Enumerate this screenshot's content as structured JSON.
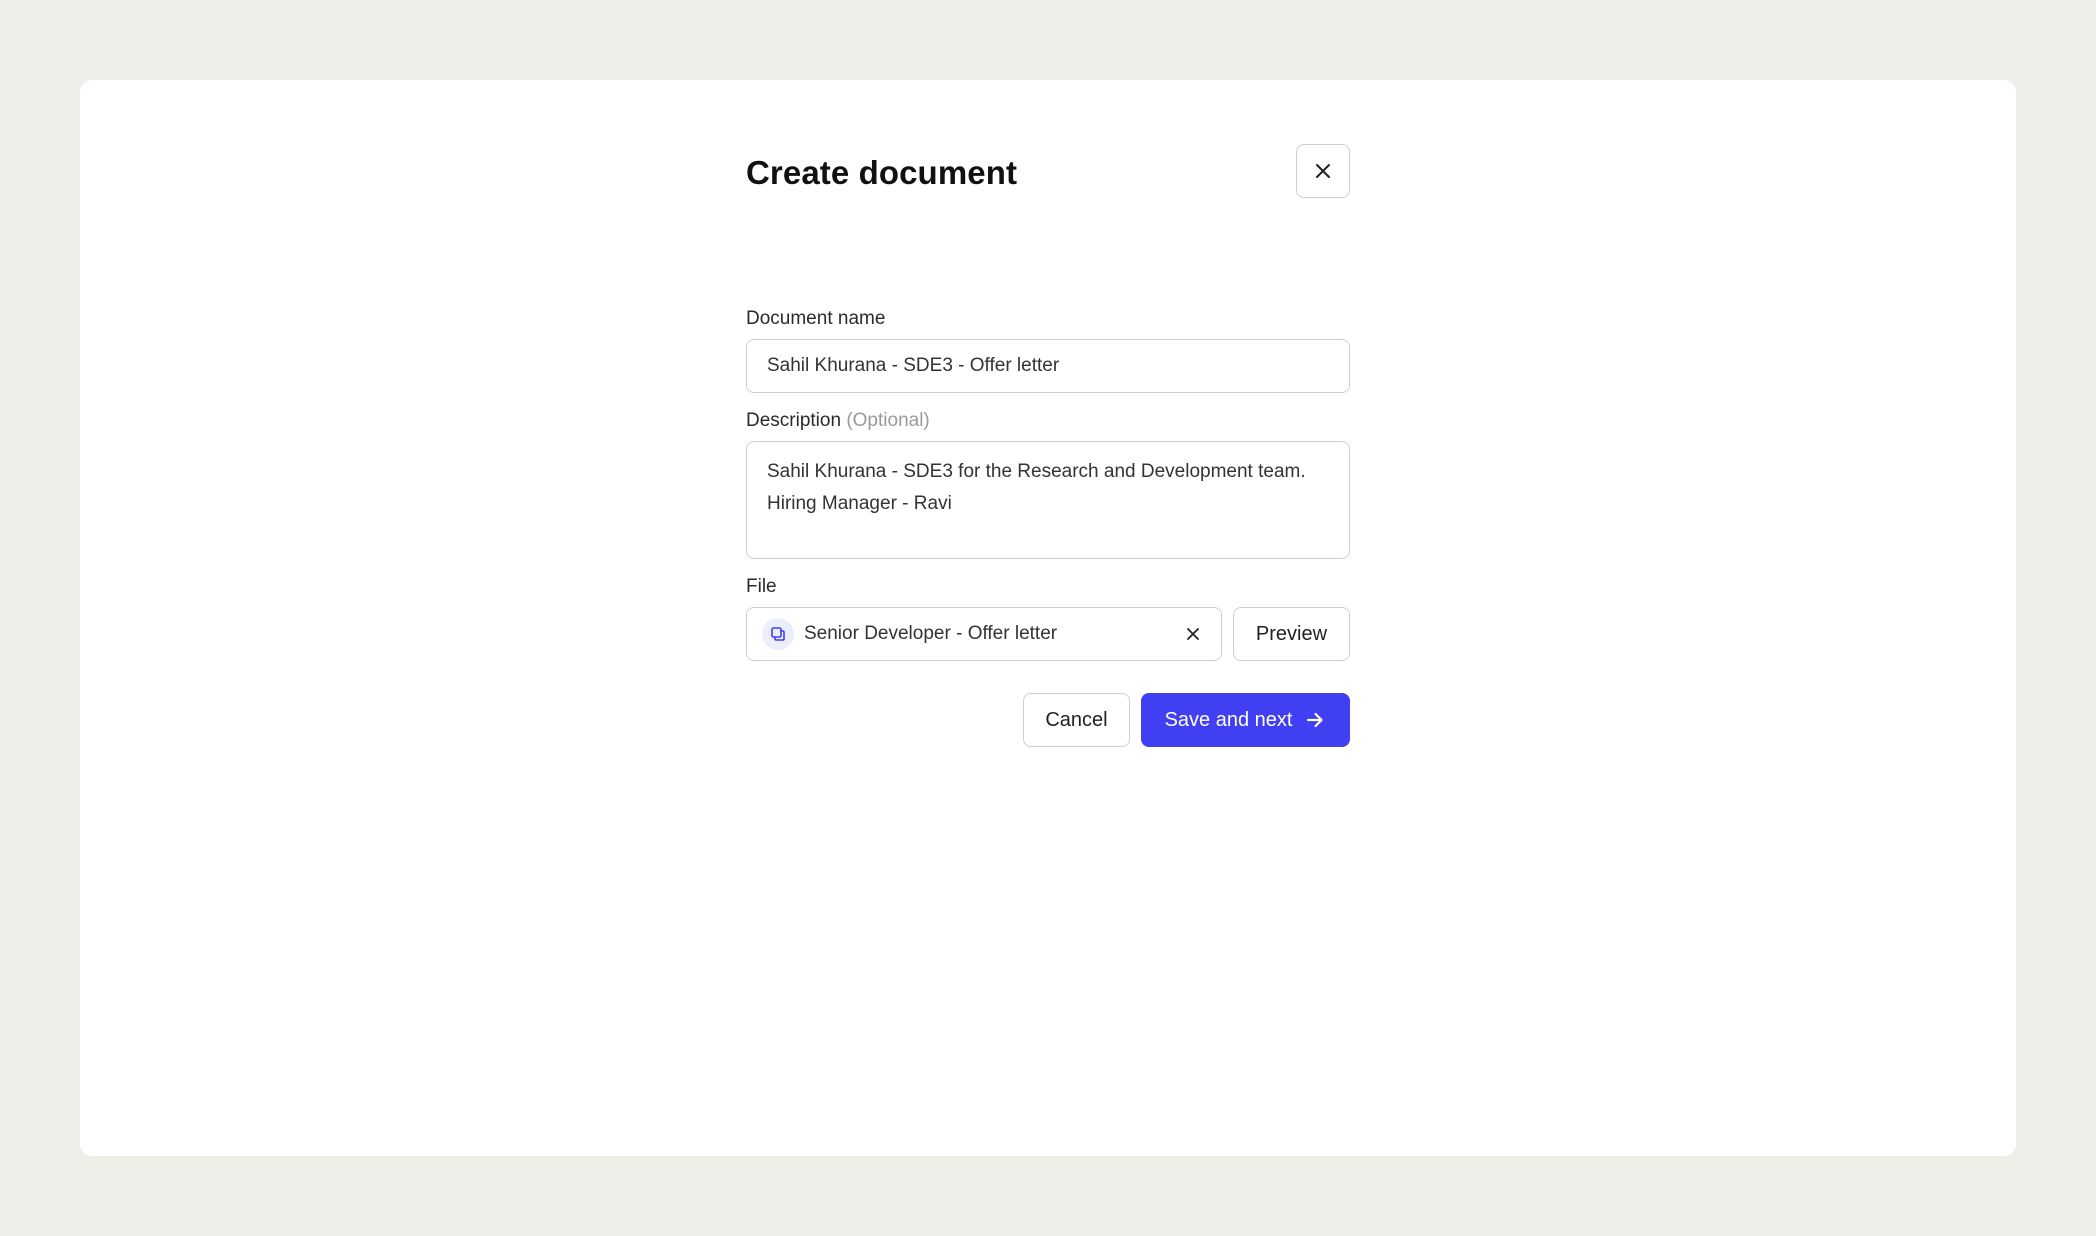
{
  "dialog": {
    "title": "Create document",
    "close_icon": "close-icon"
  },
  "document_name": {
    "label": "Document name",
    "value": "Sahil Khurana - SDE3 - Offer letter"
  },
  "description": {
    "label": "Description",
    "optional_hint": "(Optional)",
    "value": "Sahil Khurana - SDE3 for the Research and Development team.\nHiring Manager - Ravi"
  },
  "file": {
    "label": "File",
    "file_name": "Senior Developer - Offer letter",
    "file_icon": "document-copy-icon",
    "remove_icon": "close-icon",
    "preview_label": "Preview"
  },
  "actions": {
    "cancel_label": "Cancel",
    "save_label": "Save and next",
    "save_icon": "arrow-right-icon"
  },
  "colors": {
    "primary": "#4040f2",
    "background": "#eeeee8",
    "surface": "#ffffff",
    "border": "#cfcfcf",
    "muted_text": "#9a9a9a"
  }
}
